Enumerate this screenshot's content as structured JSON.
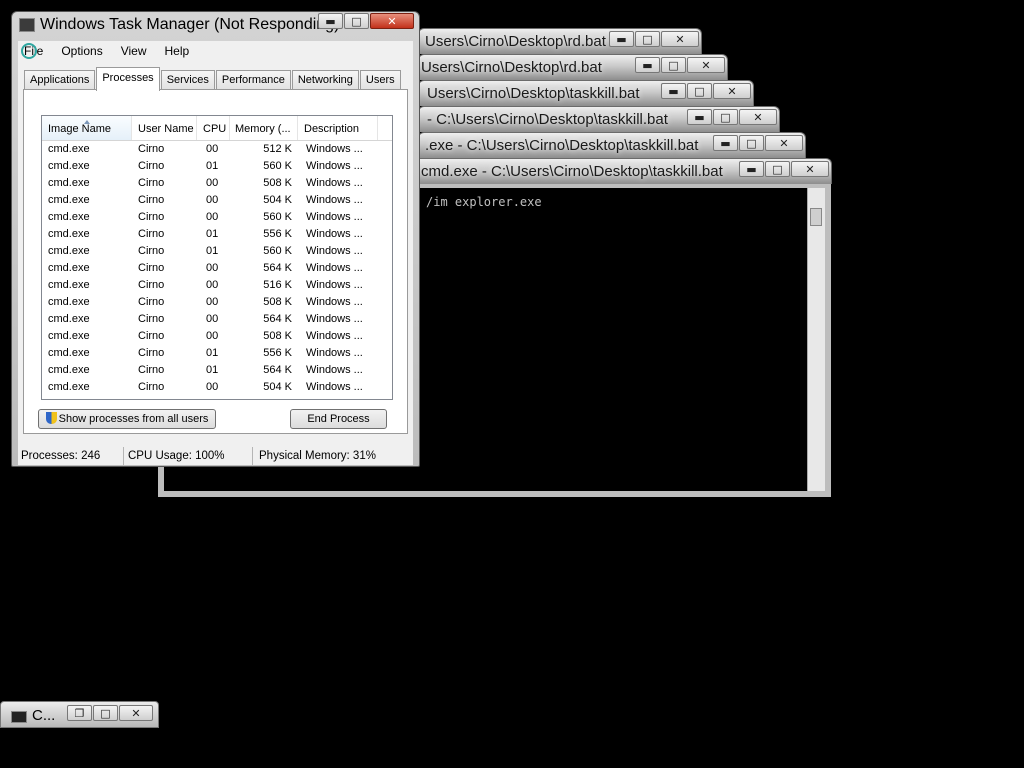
{
  "cmd_windows": [
    {
      "title": "Users\\Cirno\\Desktop\\rd.bat"
    },
    {
      "title": "Users\\Cirno\\Desktop\\rd.bat"
    },
    {
      "title": "Users\\Cirno\\Desktop\\taskkill.bat"
    },
    {
      "title": "- C:\\Users\\Cirno\\Desktop\\taskkill.bat"
    },
    {
      "title": ".exe - C:\\Users\\Cirno\\Desktop\\taskkill.bat"
    },
    {
      "title": "cmd.exe - C:\\Users\\Cirno\\Desktop\\taskkill.bat"
    }
  ],
  "cmd_console_text": "/im explorer.exe",
  "window_controls": {
    "minimize": "▬",
    "maximize": "□",
    "restore": "❐",
    "close": "✕"
  },
  "taskmgr": {
    "title": "Windows Task Manager (Not Responding)",
    "menu": [
      "File",
      "Options",
      "View",
      "Help"
    ],
    "tabs": [
      "Applications",
      "Processes",
      "Services",
      "Performance",
      "Networking",
      "Users"
    ],
    "active_tab": "Processes",
    "columns": [
      "Image Name",
      "User Name",
      "CPU",
      "Memory (...",
      "Description"
    ],
    "rows": [
      [
        "cmd.exe",
        "Cirno",
        "00",
        "512 K",
        "Windows ..."
      ],
      [
        "cmd.exe",
        "Cirno",
        "01",
        "560 K",
        "Windows ..."
      ],
      [
        "cmd.exe",
        "Cirno",
        "00",
        "508 K",
        "Windows ..."
      ],
      [
        "cmd.exe",
        "Cirno",
        "00",
        "504 K",
        "Windows ..."
      ],
      [
        "cmd.exe",
        "Cirno",
        "00",
        "560 K",
        "Windows ..."
      ],
      [
        "cmd.exe",
        "Cirno",
        "01",
        "556 K",
        "Windows ..."
      ],
      [
        "cmd.exe",
        "Cirno",
        "01",
        "560 K",
        "Windows ..."
      ],
      [
        "cmd.exe",
        "Cirno",
        "00",
        "564 K",
        "Windows ..."
      ],
      [
        "cmd.exe",
        "Cirno",
        "00",
        "516 K",
        "Windows ..."
      ],
      [
        "cmd.exe",
        "Cirno",
        "00",
        "508 K",
        "Windows ..."
      ],
      [
        "cmd.exe",
        "Cirno",
        "00",
        "564 K",
        "Windows ..."
      ],
      [
        "cmd.exe",
        "Cirno",
        "00",
        "508 K",
        "Windows ..."
      ],
      [
        "cmd.exe",
        "Cirno",
        "01",
        "556 K",
        "Windows ..."
      ],
      [
        "cmd.exe",
        "Cirno",
        "01",
        "564 K",
        "Windows ..."
      ],
      [
        "cmd.exe",
        "Cirno",
        "00",
        "504 K",
        "Windows ..."
      ]
    ],
    "show_all_button": "Show processes from all users",
    "end_process_button": "End Process",
    "status": {
      "processes": "Processes: 246",
      "cpu": "CPU Usage: 100%",
      "memory": "Physical Memory: 31%"
    }
  },
  "minimized_window": {
    "label": "C..."
  },
  "icons": {
    "app_icon": "cmd-icon",
    "shield": "uac-shield-icon"
  }
}
